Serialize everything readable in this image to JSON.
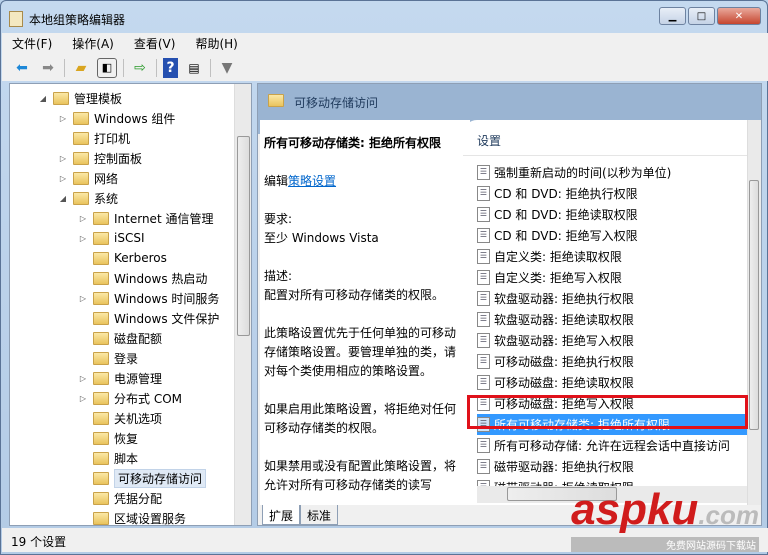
{
  "window": {
    "title": "本地组策略编辑器",
    "minimize": "▁",
    "maximize": "□",
    "close": "✕"
  },
  "menu": [
    "文件(F)",
    "操作(A)",
    "查看(V)",
    "帮助(H)"
  ],
  "tree": [
    {
      "label": "管理模板",
      "level": 0,
      "expander": "◢"
    },
    {
      "label": "Windows 组件",
      "level": 1,
      "expander": "▷"
    },
    {
      "label": "打印机",
      "level": 1,
      "expander": ""
    },
    {
      "label": "控制面板",
      "level": 1,
      "expander": "▷"
    },
    {
      "label": "网络",
      "level": 1,
      "expander": "▷"
    },
    {
      "label": "系统",
      "level": 1,
      "expander": "◢"
    },
    {
      "label": "Internet 通信管理",
      "level": 2,
      "expander": "▷"
    },
    {
      "label": "iSCSI",
      "level": 2,
      "expander": "▷"
    },
    {
      "label": "Kerberos",
      "level": 2,
      "expander": ""
    },
    {
      "label": "Windows 热启动",
      "level": 2,
      "expander": ""
    },
    {
      "label": "Windows 时间服务",
      "level": 2,
      "expander": "▷"
    },
    {
      "label": "Windows 文件保护",
      "level": 2,
      "expander": ""
    },
    {
      "label": "磁盘配额",
      "level": 2,
      "expander": ""
    },
    {
      "label": "登录",
      "level": 2,
      "expander": ""
    },
    {
      "label": "电源管理",
      "level": 2,
      "expander": "▷"
    },
    {
      "label": "分布式 COM",
      "level": 2,
      "expander": "▷"
    },
    {
      "label": "关机选项",
      "level": 2,
      "expander": ""
    },
    {
      "label": "恢复",
      "level": 2,
      "expander": ""
    },
    {
      "label": "脚本",
      "level": 2,
      "expander": ""
    },
    {
      "label": "可移动存储访问",
      "level": 2,
      "expander": "",
      "selected": true
    },
    {
      "label": "凭据分配",
      "level": 2,
      "expander": ""
    },
    {
      "label": "区域设置服务",
      "level": 2,
      "expander": ""
    }
  ],
  "header": {
    "title": "可移动存储访问"
  },
  "description": {
    "heading": "所有可移动存储类: 拒绝所有权限",
    "edit_prefix": "编辑",
    "edit_link": "策略设置",
    "req_label": "要求:",
    "req_value": "至少 Windows Vista",
    "desc_label": "描述:",
    "desc_text": "配置对所有可移动存储类的权限。",
    "para1": "此策略设置优先于任何单独的可移动存储策略设置。要管理单独的类，请对每个类使用相应的策略设置。",
    "para2": "如果启用此策略设置，将拒绝对任何可移动存储类的权限。",
    "para3": "如果禁用或没有配置此策略设置，将允许对所有可移动存储类的读写"
  },
  "list": {
    "header": "设置",
    "items": [
      "强制重新启动的时间(以秒为单位)",
      "CD 和 DVD: 拒绝执行权限",
      "CD 和 DVD: 拒绝读取权限",
      "CD 和 DVD: 拒绝写入权限",
      "自定义类: 拒绝读取权限",
      "自定义类: 拒绝写入权限",
      "软盘驱动器: 拒绝执行权限",
      "软盘驱动器: 拒绝读取权限",
      "软盘驱动器: 拒绝写入权限",
      "可移动磁盘: 拒绝执行权限",
      "可移动磁盘: 拒绝读取权限",
      "可移动磁盘: 拒绝写入权限",
      "所有可移动存储类: 拒绝所有权限",
      "所有可移动存储: 允许在远程会话中直接访问",
      "磁带驱动器: 拒绝执行权限",
      "磁带驱动器: 拒绝读取权限"
    ],
    "selected_index": 12
  },
  "tabs": [
    "扩展",
    "标准"
  ],
  "status": "19 个设置",
  "watermark": {
    "brand": "aspku",
    "suffix": ".com",
    "tagline": "免费网站源码下载站"
  },
  "colors": {
    "highlight": "#3399ff",
    "annotation": "#e0111a"
  }
}
